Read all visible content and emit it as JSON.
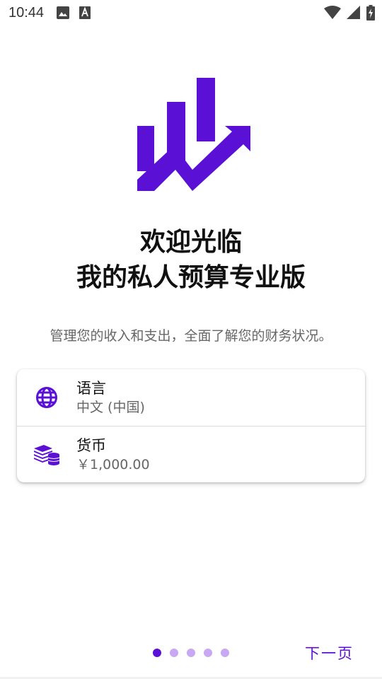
{
  "status_bar": {
    "time": "10:44",
    "icons": [
      "image-icon",
      "text-a-icon",
      "wifi-icon",
      "signal-icon",
      "battery-charging-icon"
    ]
  },
  "welcome": {
    "title_line1": "欢迎光临",
    "title_line2": "我的私人预算专业版",
    "subtitle": "管理您的收入和支出，全面了解您的财务状况。"
  },
  "settings": {
    "language": {
      "label": "语言",
      "value": "中文 (中国)",
      "icon": "globe-icon"
    },
    "currency": {
      "label": "货币",
      "value": "￥1,000.00",
      "icon": "money-stack-icon"
    }
  },
  "pager": {
    "count": 5,
    "active_index": 0
  },
  "footer": {
    "next_label": "下一页"
  },
  "colors": {
    "accent": "#5B10D6",
    "dot_inactive": "#C8A8F2"
  }
}
